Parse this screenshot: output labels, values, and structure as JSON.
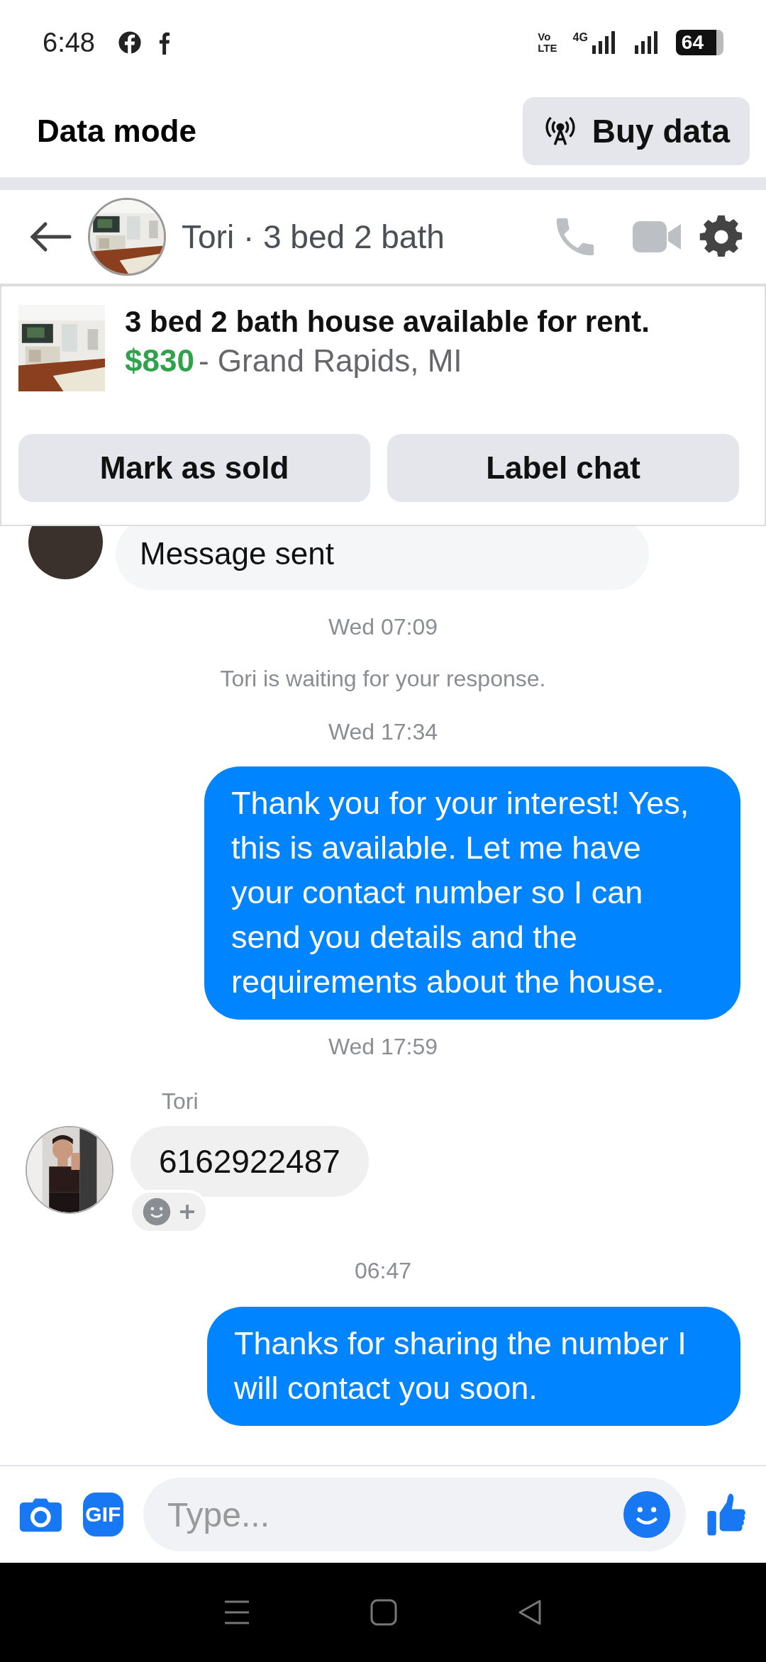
{
  "status_bar": {
    "time": "6:48",
    "volte": "Vo",
    "lte": "LTE",
    "network": "4G",
    "battery": "64"
  },
  "data_bar": {
    "title": "Data mode",
    "button": "Buy data"
  },
  "chat_header": {
    "title": "Tori · 3 bed 2 bath"
  },
  "listing": {
    "title": "3 bed 2 bath house available for rent.",
    "price": "$830",
    "location": "- Grand Rapids, MI",
    "buttons": [
      "Mark as sold",
      "Label chat"
    ]
  },
  "messages": [
    {
      "kind": "incoming_partial",
      "text": "Message sent"
    },
    {
      "kind": "time",
      "text": "Wed 07:09"
    },
    {
      "kind": "notice",
      "text": "Tori is waiting for your response."
    },
    {
      "kind": "time",
      "text": "Wed 17:34"
    },
    {
      "kind": "outgoing",
      "text": "Thank you for your interest! Yes, this is available. Let me have your contact number so I can send you details and the requirements about the house."
    },
    {
      "kind": "time",
      "text": "Wed 17:59"
    },
    {
      "kind": "incoming",
      "sender": "Tori",
      "text": "6162922487"
    },
    {
      "kind": "time",
      "text": "06:47"
    },
    {
      "kind": "outgoing",
      "text": "Thanks for sharing the number I will contact you soon."
    }
  ],
  "composer": {
    "gif": "GIF",
    "placeholder": "Type..."
  }
}
